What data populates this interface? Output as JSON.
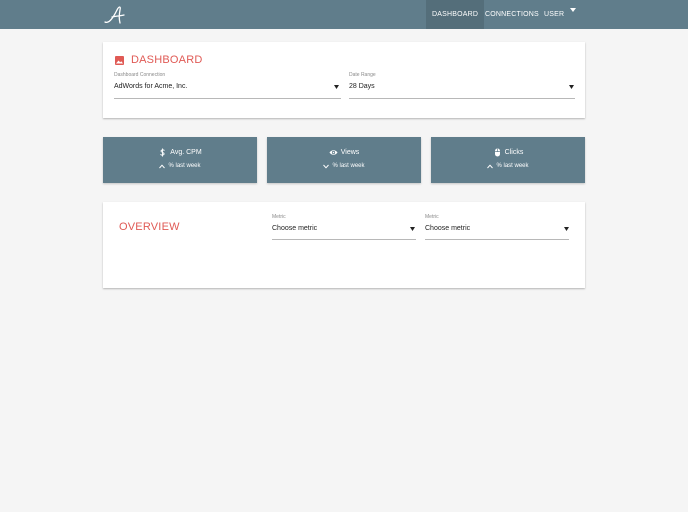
{
  "nav": {
    "items": [
      {
        "label": "DASHBOARD",
        "active": true
      },
      {
        "label": "CONNECTIONS",
        "active": false
      },
      {
        "label": "USER",
        "active": false
      }
    ]
  },
  "dashboard_card": {
    "title": "DASHBOARD",
    "icon": "image-icon",
    "connection": {
      "label": "Dashboard Connection",
      "value": "AdWords for Acme, Inc."
    },
    "date_range": {
      "label": "Date Range",
      "value": "28 Days"
    }
  },
  "stats": [
    {
      "icon": "dollar-icon",
      "label": "Avg. CPM",
      "trend_icon": "chevron-up-icon",
      "sub": "% last week"
    },
    {
      "icon": "eye-icon",
      "label": "Views",
      "trend_icon": "chevron-down-icon",
      "sub": "% last week"
    },
    {
      "icon": "mouse-icon",
      "label": "Clicks",
      "trend_icon": "chevron-up-icon",
      "sub": "% last week"
    }
  ],
  "overview_card": {
    "title": "OVERVIEW",
    "metric_1": {
      "label": "Metric",
      "value": "Choose metric"
    },
    "metric_2": {
      "label": "Metric",
      "value": "Choose metric"
    }
  },
  "colors": {
    "navbar": "#607d8b",
    "nav_active": "#546e7a",
    "accent": "#e05a55",
    "background": "#f5f5f5"
  }
}
